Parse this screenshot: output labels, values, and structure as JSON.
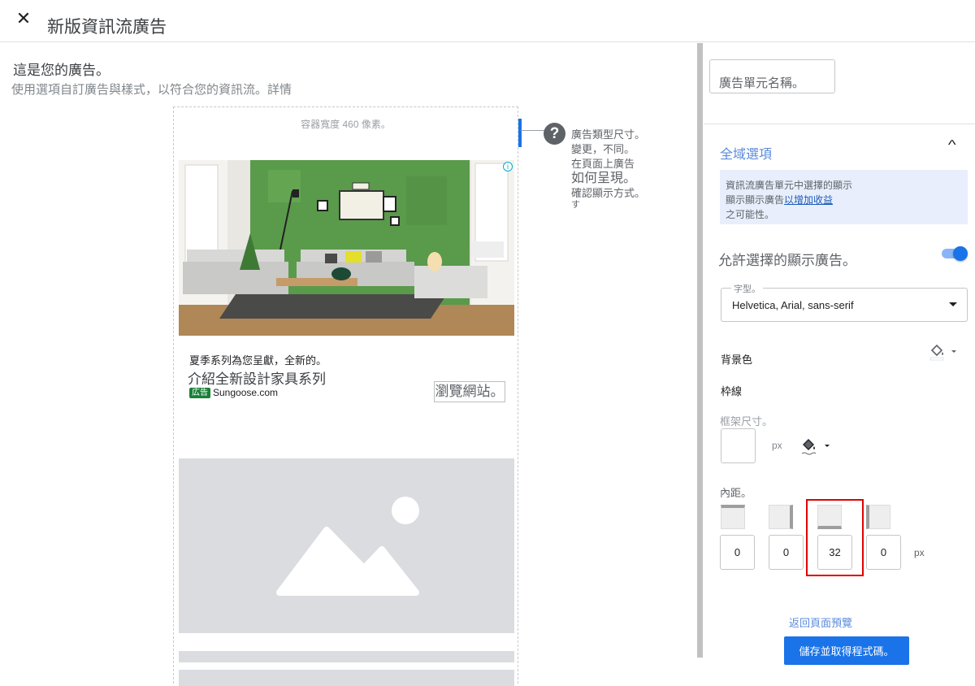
{
  "header": {
    "close_icon": "close-icon",
    "title": "新版資訊流廣告"
  },
  "intro": {
    "title": "這是您的廣告。",
    "subtitle": "使用選項自訂廣告與樣式，以符合您的資訊流。詳情"
  },
  "preview": {
    "container_label": "容器寬度 460 像素。",
    "ad": {
      "text_line1": "夏季系列為您呈獻，全新的。",
      "text_line2": "介紹全新設計家具系列",
      "badge": "広告",
      "domain": "Sungoose.com",
      "cta": "瀏覽網站。",
      "adchoices_icon": "info-icon"
    },
    "help": {
      "icon": "help-icon",
      "line1": "廣告類型尺寸。",
      "line2": "變更，不同。",
      "line3": "在頁面上廣告",
      "line4": "如何呈現。",
      "line5": "確認顯示方式。",
      "line6": "す"
    }
  },
  "sidebar": {
    "unit_name_placeholder": "廣告單元名稱。",
    "global_options": {
      "title": "全域選項",
      "chevron_icon": "chevron-up-icon",
      "info_line1": "資訊流廣告單元中選擇的顯示",
      "info_line2_plain": "顯示顯示廣告",
      "info_line2_link": "以增加收益",
      "info_line3": "之可能性。"
    },
    "allow_display_ads": {
      "label": "允許選擇的顯示廣告。",
      "enabled": true
    },
    "font": {
      "label": "字型。",
      "value": "Helvetica, Arial, sans-serif"
    },
    "background_color_label": "背景色",
    "border_label": "枠線",
    "frame_size_label": "框架尺寸。",
    "frame_px": "px",
    "padding": {
      "label": "內距。",
      "values": [
        "0",
        "0",
        "32",
        "0"
      ],
      "unit": "px"
    },
    "back_link": "返回頁面預覽",
    "save_button": "儲存並取得程式碼。"
  },
  "colors": {
    "primary": "#1a73e8",
    "link": "#5b8bdc",
    "highlight": "#e00000",
    "info_bg": "#e8eefc"
  }
}
